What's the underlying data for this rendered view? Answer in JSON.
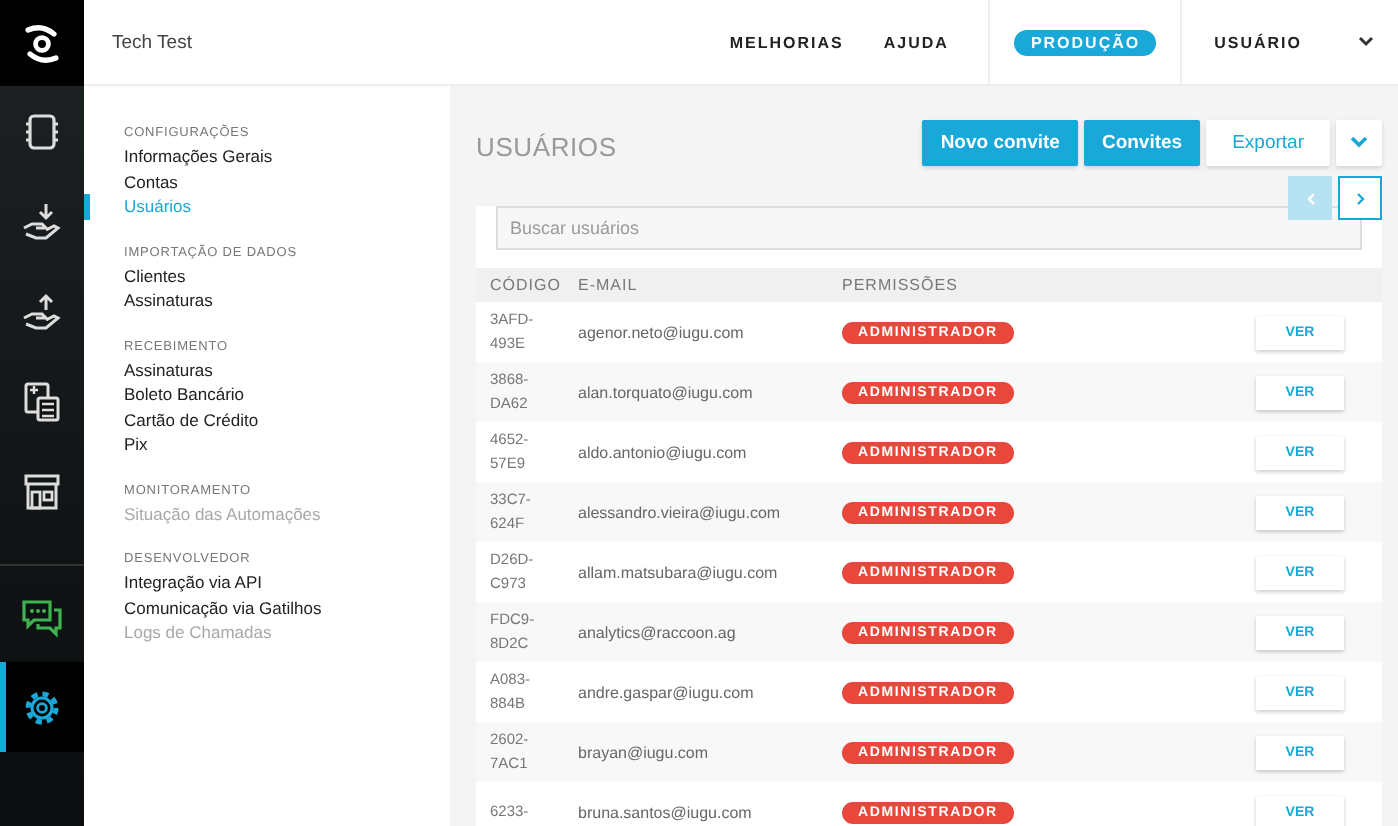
{
  "header": {
    "account": "Tech Test",
    "links": [
      {
        "label": "MELHORIAS"
      },
      {
        "label": "AJUDA"
      }
    ],
    "environment": "PRODUÇÃO",
    "user_menu": "USUÁRIO"
  },
  "rail": [
    {
      "kind": "chip",
      "selected": false
    },
    {
      "kind": "hand-down",
      "selected": false
    },
    {
      "kind": "hand-up",
      "selected": false
    },
    {
      "kind": "calculator",
      "selected": false
    },
    {
      "kind": "store",
      "selected": false
    },
    {
      "kind": "chat",
      "selected": false
    },
    {
      "kind": "gear",
      "selected": true
    }
  ],
  "settings_menu": [
    {
      "heading": "CONFIGURAÇÕES",
      "items": [
        {
          "label": "Informações Gerais",
          "selected": false,
          "disabled": false
        },
        {
          "label": "Contas",
          "selected": false,
          "disabled": false
        },
        {
          "label": "Usuários",
          "selected": true,
          "disabled": false
        }
      ]
    },
    {
      "heading": "IMPORTAÇÃO DE DADOS",
      "items": [
        {
          "label": "Clientes",
          "selected": false,
          "disabled": false
        },
        {
          "label": "Assinaturas",
          "selected": false,
          "disabled": false
        }
      ]
    },
    {
      "heading": "RECEBIMENTO",
      "items": [
        {
          "label": "Assinaturas",
          "selected": false,
          "disabled": false
        },
        {
          "label": "Boleto Bancário",
          "selected": false,
          "disabled": false
        },
        {
          "label": "Cartão de Crédito",
          "selected": false,
          "disabled": false
        },
        {
          "label": "Pix",
          "selected": false,
          "disabled": false
        }
      ]
    },
    {
      "heading": "MONITORAMENTO",
      "items": [
        {
          "label": "Situação das Automações",
          "selected": false,
          "disabled": true
        }
      ]
    },
    {
      "heading": "DESENVOLVEDOR",
      "items": [
        {
          "label": "Integração via API",
          "selected": false,
          "disabled": false
        },
        {
          "label": "Comunicação via Gatilhos",
          "selected": false,
          "disabled": false
        },
        {
          "label": "Logs de Chamadas",
          "selected": false,
          "disabled": true
        }
      ]
    }
  ],
  "page": {
    "title": "USUÁRIOS",
    "buttons": [
      {
        "label": "Novo convite",
        "kind": "primary"
      },
      {
        "label": "Convites",
        "kind": "primary"
      },
      {
        "label": "Exportar",
        "kind": "outline"
      }
    ],
    "pager": {
      "prev_disabled": true,
      "next_disabled": false
    },
    "search": {
      "placeholder": "Buscar usuários"
    },
    "table": {
      "columns": [
        "CÓDIGO",
        "E-MAIL",
        "PERMISSÕES"
      ],
      "rows": [
        {
          "code": "3AFD-493E",
          "email": "agenor.neto@iugu.com",
          "permission": "ADMINISTRADOR",
          "action": "VER"
        },
        {
          "code": "3868-DA62",
          "email": "alan.torquato@iugu.com",
          "permission": "ADMINISTRADOR",
          "action": "VER"
        },
        {
          "code": "4652-57E9",
          "email": "aldo.antonio@iugu.com",
          "permission": "ADMINISTRADOR",
          "action": "VER"
        },
        {
          "code": "33C7-624F",
          "email": "alessandro.vieira@iugu.com",
          "permission": "ADMINISTRADOR",
          "action": "VER"
        },
        {
          "code": "D26D-C973",
          "email": "allam.matsubara@iugu.com",
          "permission": "ADMINISTRADOR",
          "action": "VER"
        },
        {
          "code": "FDC9-8D2C",
          "email": "analytics@raccoon.ag",
          "permission": "ADMINISTRADOR",
          "action": "VER"
        },
        {
          "code": "A083-884B",
          "email": "andre.gaspar@iugu.com",
          "permission": "ADMINISTRADOR",
          "action": "VER"
        },
        {
          "code": "2602-7AC1",
          "email": "brayan@iugu.com",
          "permission": "ADMINISTRADOR",
          "action": "VER"
        },
        {
          "code": "6233-",
          "email": "bruna.santos@iugu.com",
          "permission": "ADMINISTRADOR",
          "action": "VER"
        }
      ]
    }
  }
}
